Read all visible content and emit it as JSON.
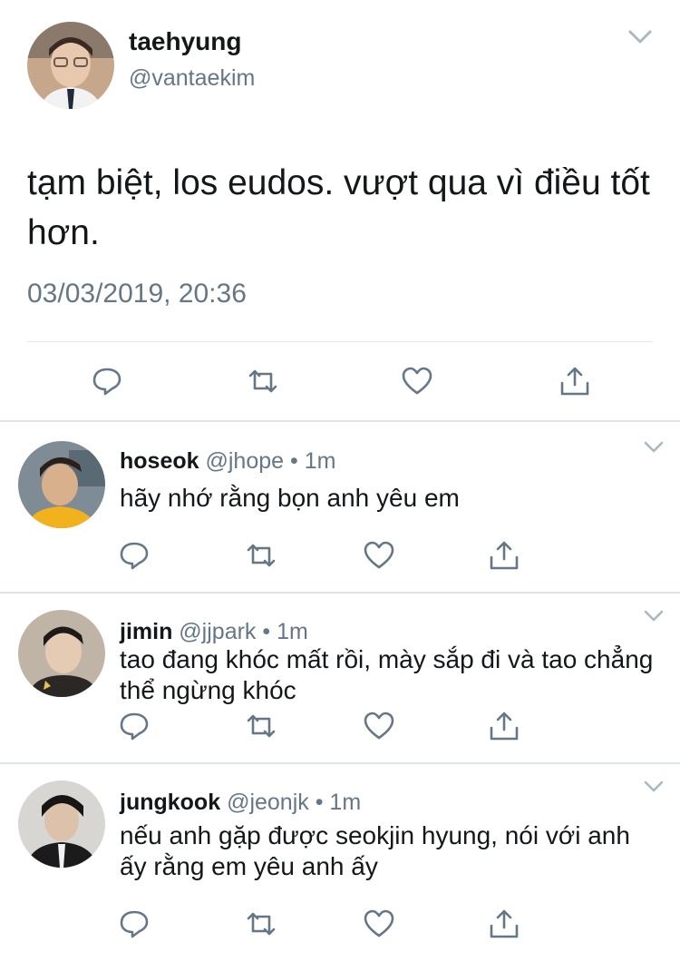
{
  "main": {
    "name": "taehyung",
    "handle": "@vantaekim",
    "text": "tạm biệt, los eudos. vượt qua vì điều tốt hơn.",
    "timestamp": "03/03/2019, 20:36",
    "icons": [
      "reply-icon",
      "retweet-icon",
      "like-icon",
      "share-icon"
    ]
  },
  "replies": [
    {
      "name": "hoseok",
      "handle": "@jhope",
      "separator": " • ",
      "time": "1m",
      "text": "hãy nhớ rằng bọn anh yêu em"
    },
    {
      "name": "jimin",
      "handle": "@jjpark",
      "separator": " • ",
      "time": "1m",
      "text": "tao đang khóc mất rồi, mày sắp đi và tao chẳng thể ngừng khóc"
    },
    {
      "name": "jungkook",
      "handle": "@jeonjk",
      "separator": " • ",
      "time": "1m",
      "text": "nếu anh gặp được seokjin hyung, nói với anh ấy rằng em yêu anh ấy"
    }
  ],
  "colors": {
    "primary_text": "#14171a",
    "secondary_text": "#657786",
    "icon": "#657786",
    "divider": "#e1e8ed"
  }
}
